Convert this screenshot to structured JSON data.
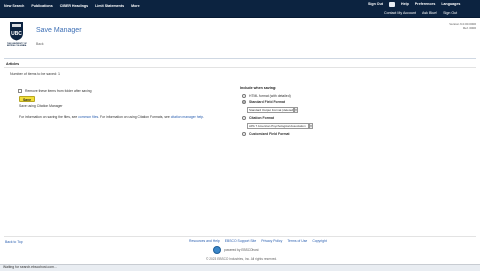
{
  "topbar": {
    "nav": [
      "New Search",
      "Publications",
      "CIBER Headings",
      "Limit Statements",
      "More"
    ],
    "right_row1": [
      "Sign Out",
      "Help",
      "Preferences",
      "Languages"
    ],
    "right_row2": [
      "Contact My Account",
      "Ask Blue!",
      "Sign Out"
    ]
  },
  "header": {
    "logo_text": "UBC",
    "logo_caption": "THE UNIVERSITY OF BRITISH COLUMBIA",
    "title": "Save Manager",
    "subtitle": "Back",
    "right_info": [
      "Version 6.0.00.0000",
      "Ref. 0000"
    ]
  },
  "main": {
    "section_title": "Articles",
    "items_count": "Number of items to be saved: 1",
    "checkbox_label": "Remove these items from folder after saving",
    "save_button": "Save",
    "sub_link": "Save using Citation Manager",
    "info_prefix": "For information on saving the files, see ",
    "info_link1": "common files",
    "info_middle": ". For information on using Citation Formats, see ",
    "info_link2": "citation manager help",
    "info_suffix": "."
  },
  "options": {
    "heading": "Include when saving:",
    "opt1": "HTML format (with detailed)",
    "opt2": "Standard Field Format",
    "select1": "Standard Output Format (deleted)",
    "opt3": "Citation Format",
    "select2": "APA 7 American Psychological Association",
    "opt4": "Customized Field Format"
  },
  "footer": {
    "back_to_top": "Back to Top",
    "links": [
      "Resources and Help",
      "EBSCO Support Site",
      "Privacy Policy",
      "Terms of Use",
      "Copyright"
    ],
    "powered": "powered by EBSCOhost",
    "copyright": "© 2023 EBSCO Industries, Inc. All rights reserved."
  },
  "status": {
    "text": "Waiting for search.ebscohost.com..."
  }
}
